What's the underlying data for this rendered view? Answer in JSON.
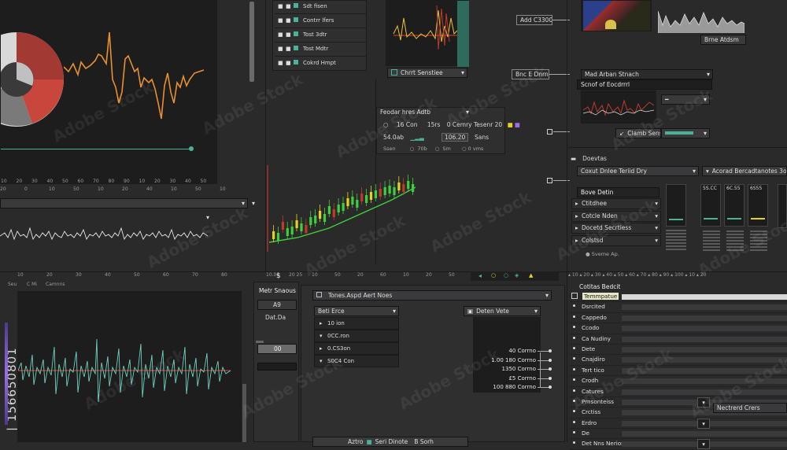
{
  "colors": {
    "accent_orange": "#e8902c",
    "red": "#c0392b",
    "teal": "#4bb29a",
    "green": "#3ecf3e",
    "yellow": "#e6d11f",
    "highlight": "#d8d8d8"
  },
  "top_left": {
    "ticks": [
      "10",
      "20",
      "30",
      "40",
      "50",
      "60",
      "70",
      "80",
      "90",
      "10",
      "20",
      "30",
      "40",
      "50"
    ],
    "ruler2": [
      "20",
      "0",
      "10",
      "50",
      "10",
      "20",
      "40",
      "10",
      "50",
      "10"
    ]
  },
  "layer_list": {
    "items": [
      "Sdt fisen",
      "Contrr lfers",
      "Tost 3dtr",
      "Tost Mdtr",
      "Cokrd Hmpt"
    ]
  },
  "top_mid": {
    "dropdown": "Chrrt Senstiee",
    "label_a": "Add C3300%",
    "label_b": "Bnc E Dnrne"
  },
  "mid_panel": {
    "header": "Feodar hres Adtb",
    "row1": [
      "16 Con",
      "15rs",
      "0 Cemry Tesenr 20"
    ],
    "row2": [
      "54.0ab",
      "106.20",
      "Sans"
    ],
    "row3": [
      "Ssen",
      "70b",
      "Sm",
      "0 vms"
    ]
  },
  "candles": {
    "ticks": [
      "10.00",
      "20 25",
      "10",
      "50",
      "20",
      "60",
      "10",
      "20",
      "50",
      "20",
      "00",
      "10",
      "00"
    ],
    "toolbar": "$"
  },
  "right_top": {
    "label": "Brne Atdsm",
    "dropdown": "Mad Arban Stnach",
    "sub": "Scnof of Eocdrrrl",
    "btn": "Clamb Sens"
  },
  "right_mid": {
    "header": "Doevtas",
    "dd1": "Coxut Dnlee Teriid Dry",
    "dd2": "Acorad Bercadtanotes 3o",
    "title": "Bove Detin",
    "items": [
      "Ctitdhee",
      "Cotcle Nden",
      "Docetd Secrtiess",
      "Colstsd"
    ],
    "gauges": [
      "5S.CC",
      "6C.55",
      "6S55"
    ],
    "foot": "Sveme Ap."
  },
  "right_list": {
    "title": "Cotitas Bedcit",
    "items": [
      "Temmpatue",
      "Dsrcited",
      "Cappedo",
      "Ccodo",
      "Ca Nudiny",
      "Dete",
      "Cnajdiro",
      "Tert tico",
      "Crodh",
      "Catures",
      "Prnsonteiss",
      "Crctiss",
      "Erdro",
      "De",
      "Det Nns Nerios"
    ],
    "side": "Nectrerd Crers"
  },
  "bottom_left": {
    "labels": [
      "Seu",
      "C Mi",
      "Camnns"
    ],
    "ticks": [
      "10",
      "20",
      "30",
      "40",
      "50",
      "60",
      "70",
      "80"
    ]
  },
  "bottom_mid": {
    "side_title": "Metr Snaous",
    "side_btn1": "A9",
    "side_label": "Dat.Da",
    "side_btn2": "00",
    "header": "Tones.Aspd Aert Noes",
    "dd": "Beti Erce",
    "rows": [
      "10 ion",
      "0CC.ron",
      "0.CS3on",
      "S0C4 Con"
    ],
    "value_dd": "Deten Vete",
    "values": [
      "40 Corrno",
      "1.00 180 Corrno",
      "1350 Corrno",
      "£5 Corrno",
      "100 880 Corrno"
    ],
    "footer": [
      "Aztro",
      "Seri Dinote",
      "B Sorh"
    ]
  },
  "watermark": "Adobe Stock",
  "stock_id": "| 156650801"
}
